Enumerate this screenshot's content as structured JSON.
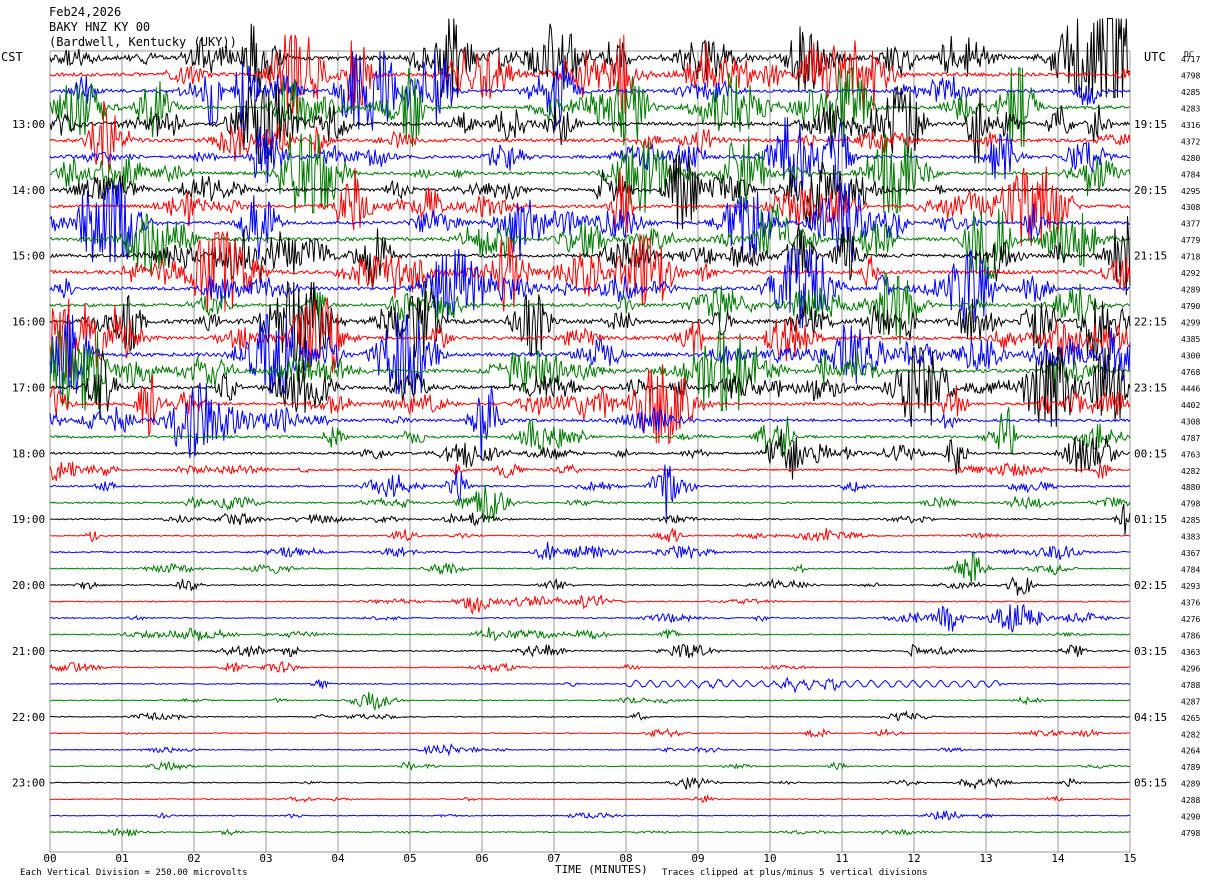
{
  "header": {
    "date": "Feb24,2026",
    "station": "BAKY HNZ KY 00",
    "location": "(Bardwell, Kentucky (UKY))"
  },
  "left_axis_label": "CST",
  "right_axis_label": "UTC",
  "dc_label": "DC",
  "footer": {
    "scale_note": "Each Vertical Division =  250.00 microvolts",
    "clip_note": "Traces clipped at plus/minus 5 vertical divisions",
    "xlabel": "TIME (MINUTES)"
  },
  "colors": {
    "trace_cycle": [
      "#000000",
      "#ff0000",
      "#0000ff",
      "#007a00"
    ],
    "grid": "#999999",
    "background": "#ffffff"
  },
  "chart_data": {
    "type": "line",
    "subtype": "helicorder",
    "xlim": [
      0,
      15
    ],
    "x_ticks": [
      "00",
      "01",
      "02",
      "03",
      "04",
      "05",
      "06",
      "07",
      "08",
      "09",
      "10",
      "11",
      "12",
      "13",
      "14",
      "15"
    ],
    "traces_per_hour": 4,
    "trace_minutes": 15,
    "left_hour_labels": [
      {
        "row": 4,
        "label": "13:00"
      },
      {
        "row": 8,
        "label": "14:00"
      },
      {
        "row": 12,
        "label": "15:00"
      },
      {
        "row": 16,
        "label": "16:00"
      },
      {
        "row": 20,
        "label": "17:00"
      },
      {
        "row": 24,
        "label": "18:00"
      },
      {
        "row": 28,
        "label": "19:00"
      },
      {
        "row": 32,
        "label": "20:00"
      },
      {
        "row": 36,
        "label": "21:00"
      },
      {
        "row": 40,
        "label": "22:00"
      },
      {
        "row": 44,
        "label": "23:00"
      }
    ],
    "right_hour_labels": [
      {
        "row": 4,
        "label": "19:15"
      },
      {
        "row": 8,
        "label": "20:15"
      },
      {
        "row": 12,
        "label": "21:15"
      },
      {
        "row": 16,
        "label": "22:15"
      },
      {
        "row": 20,
        "label": "23:15"
      },
      {
        "row": 24,
        "label": "00:15"
      },
      {
        "row": 28,
        "label": "01:15"
      },
      {
        "row": 32,
        "label": "02:15"
      },
      {
        "row": 36,
        "label": "03:15"
      },
      {
        "row": 40,
        "label": "04:15"
      },
      {
        "row": 44,
        "label": "05:15"
      }
    ],
    "dc_offsets": [
      "4717",
      "4798",
      "4285",
      "4283",
      "4316",
      "4372",
      "4280",
      "4784",
      "4295",
      "4308",
      "4377",
      "4779",
      "4718",
      "4292",
      "4289",
      "4790",
      "4299",
      "4385",
      "4300",
      "4768",
      "4446",
      "4402",
      "4308",
      "4787",
      "4763",
      "4282",
      "4880",
      "4798",
      "4285",
      "4383",
      "4367",
      "4784",
      "4293",
      "4376",
      "4276",
      "4786",
      "4363",
      "4296",
      "4788",
      "4287",
      "4265",
      "4282",
      "4264",
      "4789",
      "4289",
      "4288",
      "4290",
      "4798"
    ],
    "trace_activity": [
      3.2,
      2.6,
      2.4,
      2.4,
      2.6,
      2.3,
      2.3,
      2.2,
      2.2,
      2.2,
      2.4,
      2.5,
      2.6,
      2.6,
      2.4,
      2.4,
      3.0,
      2.6,
      2.8,
      2.8,
      2.4,
      2.2,
      2.0,
      1.8,
      1.6,
      1.4,
      1.3,
      1.2,
      1.1,
      1.0,
      1.0,
      0.9,
      0.9,
      0.9,
      0.9,
      0.9,
      0.9,
      0.8,
      0.8,
      0.7,
      0.7,
      0.7,
      0.7,
      0.7,
      0.7,
      0.7,
      0.7,
      0.6
    ],
    "tremor_segment": {
      "row": 38,
      "start_minute": 8.0,
      "end_minute": 13.2
    }
  }
}
